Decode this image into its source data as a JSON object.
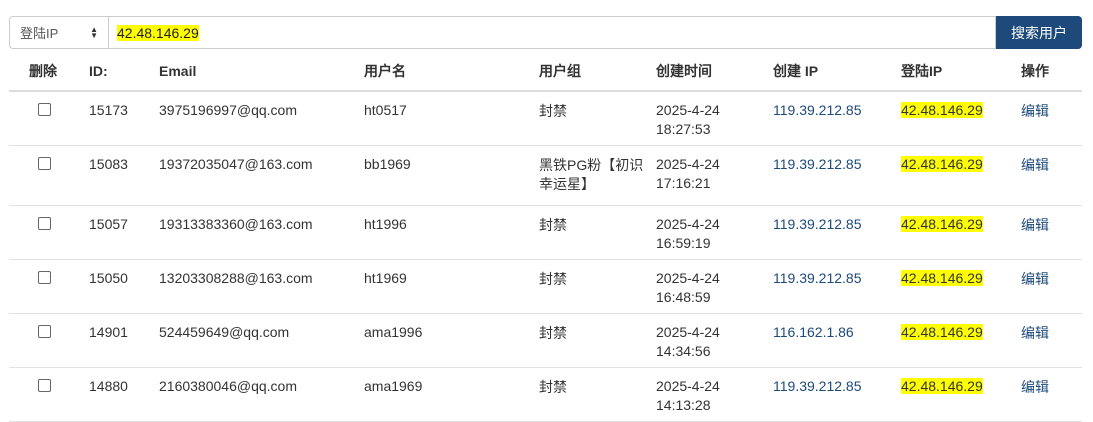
{
  "search": {
    "field_select": "登陆IP",
    "query": "42.48.146.29",
    "button": "搜索用户"
  },
  "table": {
    "headers": [
      "删除",
      "ID:",
      "Email",
      "用户名",
      "用户组",
      "创建时间",
      "创建 IP",
      "登陆IP",
      "操作"
    ],
    "rows": [
      {
        "id": "15173",
        "email": "3975196997@qq.com",
        "username": "ht0517",
        "group": "封禁",
        "date": "2025-4-24",
        "time": "18:27:53",
        "create_ip": "119.39.212.85",
        "login_ip": "42.48.146.29",
        "action": "编辑"
      },
      {
        "id": "15083",
        "email": "19372035047@163.com",
        "username": "bb1969",
        "group": "黑铁PG粉【初识幸运星】",
        "date": "2025-4-24",
        "time": "17:16:21",
        "create_ip": "119.39.212.85",
        "login_ip": "42.48.146.29",
        "action": "编辑"
      },
      {
        "id": "15057",
        "email": "19313383360@163.com",
        "username": "ht1996",
        "group": "封禁",
        "date": "2025-4-24",
        "time": "16:59:19",
        "create_ip": "119.39.212.85",
        "login_ip": "42.48.146.29",
        "action": "编辑"
      },
      {
        "id": "15050",
        "email": "13203308288@163.com",
        "username": "ht1969",
        "group": "封禁",
        "date": "2025-4-24",
        "time": "16:48:59",
        "create_ip": "119.39.212.85",
        "login_ip": "42.48.146.29",
        "action": "编辑"
      },
      {
        "id": "14901",
        "email": "524459649@qq.com",
        "username": "ama1996",
        "group": "封禁",
        "date": "2025-4-24",
        "time": "14:34:56",
        "create_ip": "116.162.1.86",
        "login_ip": "42.48.146.29",
        "action": "编辑"
      },
      {
        "id": "14880",
        "email": "2160380046@qq.com",
        "username": "ama1969",
        "group": "封禁",
        "date": "2025-4-24",
        "time": "14:13:28",
        "create_ip": "119.39.212.85",
        "login_ip": "42.48.146.29",
        "action": "编辑"
      }
    ]
  }
}
